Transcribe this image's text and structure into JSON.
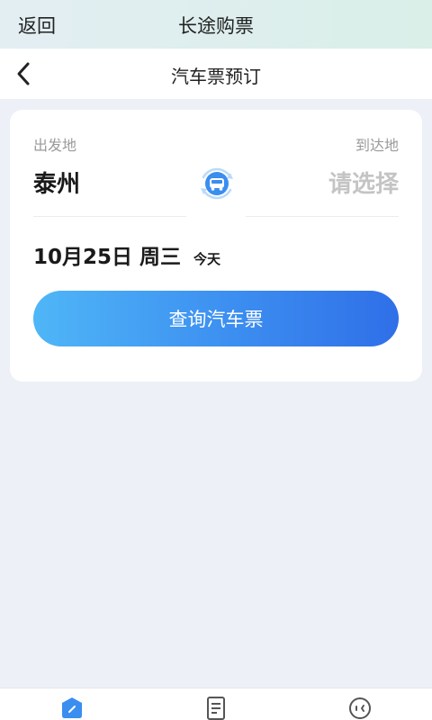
{
  "top_bar": {
    "back_label": "返回",
    "title": "长途购票"
  },
  "header": {
    "title": "汽车票预订",
    "back_icon": "chevron-left-icon"
  },
  "search_card": {
    "from_label": "出发地",
    "to_label": "到达地",
    "from_city": "泰州",
    "to_placeholder": "请选择",
    "swap_icon": "bus-swap-icon",
    "date": "10月25日 周三",
    "date_tag": "今天",
    "search_button": "查询汽车票"
  },
  "tab_bar": {
    "tabs": [
      {
        "icon": "booking-icon",
        "active": true
      },
      {
        "icon": "orders-icon",
        "active": false
      },
      {
        "icon": "profile-icon",
        "active": false
      }
    ]
  },
  "colors": {
    "accent_start": "#4fb6f7",
    "accent_end": "#2f6fe8",
    "page_bg": "#edf0f7",
    "top_bar_bg": "#e3eef3"
  }
}
